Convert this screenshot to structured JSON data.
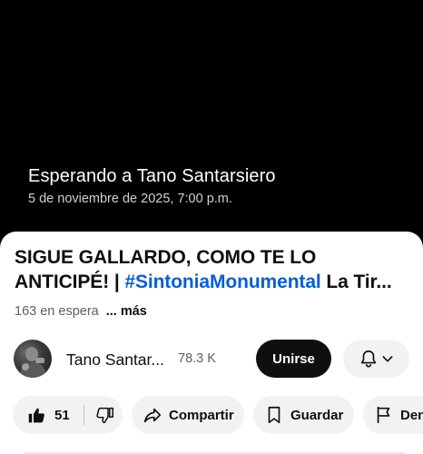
{
  "player": {
    "status": "Esperando a Tano Santarsiero",
    "scheduled": "5 de noviembre de 2025, 7:00 p.m."
  },
  "video": {
    "title_line1": "SIGUE GALLARDO, COMO TE LO",
    "title_line2_prefix": "ANTICIPÉ! | ",
    "title_hashtag": "#SintoniaMonumental",
    "title_line2_suffix": " La Tir...",
    "waiting_count": "163 en espera",
    "more_label": "... más"
  },
  "channel": {
    "name": "Tano Santar...",
    "subscribers": "78.3 K",
    "join_label": "Unirse"
  },
  "actions": {
    "likes": "51",
    "share_label": "Compartir",
    "save_label": "Guardar",
    "report_label": "Denu"
  },
  "colors": {
    "hashtag": "#065fd4",
    "join_bg": "#0f0f0f",
    "pill_bg": "#f2f2f2"
  }
}
